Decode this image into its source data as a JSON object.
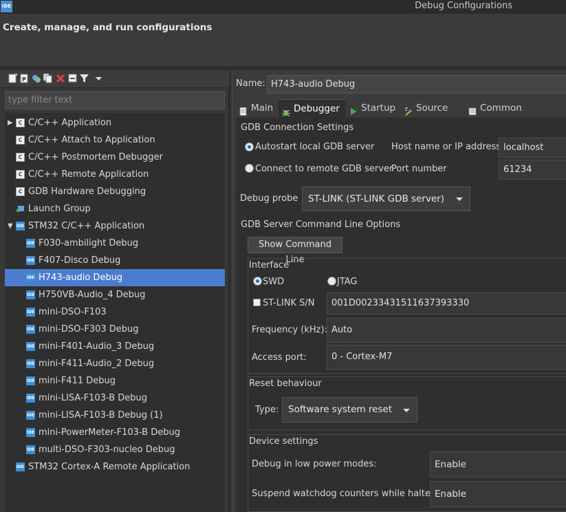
{
  "window": {
    "title": "Debug Configurations",
    "app_icon_text": "IDE"
  },
  "header": {
    "title": "Create, manage, and run configurations"
  },
  "toolbar": {
    "icons": [
      "new-config-icon",
      "new-prototype-icon",
      "export-icon",
      "duplicate-icon",
      "delete-icon",
      "collapse-all-icon",
      "filter-icon",
      "view-menu-icon"
    ]
  },
  "filter": {
    "placeholder": "type filter text"
  },
  "tree": {
    "items": [
      {
        "label": "C/C++ Application",
        "icon": "c-icon",
        "level": 0,
        "expander": "collapsed"
      },
      {
        "label": "C/C++ Attach to Application",
        "icon": "c-icon",
        "level": 0
      },
      {
        "label": "C/C++ Postmortem Debugger",
        "icon": "c-icon",
        "level": 0
      },
      {
        "label": "C/C++ Remote Application",
        "icon": "c-icon",
        "level": 0
      },
      {
        "label": "GDB Hardware Debugging",
        "icon": "c-icon",
        "level": 0
      },
      {
        "label": "Launch Group",
        "icon": "launch-group-icon",
        "level": 0
      },
      {
        "label": "STM32 C/C++ Application",
        "icon": "ide-icon",
        "level": 0,
        "expander": "expanded"
      },
      {
        "label": "F030-ambilight Debug",
        "icon": "ide-icon",
        "level": 1
      },
      {
        "label": "F407-Disco Debug",
        "icon": "ide-icon",
        "level": 1
      },
      {
        "label": "H743-audio Debug",
        "icon": "ide-icon",
        "level": 1,
        "selected": true
      },
      {
        "label": "H750VB-Audio_4 Debug",
        "icon": "ide-icon",
        "level": 1
      },
      {
        "label": "mini-DSO-F103",
        "icon": "ide-icon",
        "level": 1
      },
      {
        "label": "mini-DSO-F303 Debug",
        "icon": "ide-icon",
        "level": 1
      },
      {
        "label": "mini-F401-Audio_3 Debug",
        "icon": "ide-icon",
        "level": 1
      },
      {
        "label": "mini-F411-Audio_2 Debug",
        "icon": "ide-icon",
        "level": 1
      },
      {
        "label": "mini-F411 Debug",
        "icon": "ide-icon",
        "level": 1
      },
      {
        "label": "mini-LISA-F103-B Debug",
        "icon": "ide-icon",
        "level": 1
      },
      {
        "label": "mini-LISA-F103-B Debug (1)",
        "icon": "ide-icon",
        "level": 1
      },
      {
        "label": "mini-PowerMeter-F103-B Debug",
        "icon": "ide-icon",
        "level": 1
      },
      {
        "label": "multi-DSO-F303-nucleo Debug",
        "icon": "ide-icon",
        "level": 1
      },
      {
        "label": "STM32 Cortex-A Remote Application",
        "icon": "ide-icon",
        "level": 0
      }
    ]
  },
  "config": {
    "name_label": "Name:",
    "name_value": "H743-audio Debug",
    "tabs": [
      {
        "label": "Main",
        "icon": "main-tab-icon"
      },
      {
        "label": "Debugger",
        "icon": "debugger-tab-icon",
        "active": true
      },
      {
        "label": "Startup",
        "icon": "startup-tab-icon"
      },
      {
        "label": "Source",
        "icon": "source-tab-icon"
      },
      {
        "label": "Common",
        "icon": "common-tab-icon"
      }
    ]
  },
  "gdb_connection": {
    "title": "GDB Connection Settings",
    "autostart_label": "Autostart local GDB server",
    "autostart_selected": true,
    "remote_label": "Connect to remote GDB server",
    "host_label": "Host name or IP address",
    "host_value": "localhost",
    "port_label": "Port number",
    "port_value": "61234"
  },
  "debug_probe": {
    "label": "Debug probe",
    "value": "ST-LINK (ST-LINK GDB server)"
  },
  "server_options": {
    "title": "GDB Server Command Line Options",
    "show_cmd_button": "Show Command Line",
    "interface": {
      "title": "Interface",
      "swd_label": "SWD",
      "swd_selected": true,
      "jtag_label": "JTAG",
      "stlink_sn_label": "ST-LINK S/N",
      "stlink_sn_checked": false,
      "stlink_sn_value": "001D00233431511637393330",
      "frequency_label": "Frequency (kHz):",
      "frequency_value": "Auto",
      "access_port_label": "Access port:",
      "access_port_value": "0 - Cortex-M7"
    },
    "reset": {
      "title": "Reset behaviour",
      "type_label": "Type:",
      "type_value": "Software system reset"
    },
    "device": {
      "title": "Device settings",
      "low_power_label": "Debug in low power modes:",
      "low_power_value": "Enable",
      "watchdog_label": "Suspend watchdog counters while halted:",
      "watchdog_value": "Enable"
    }
  }
}
